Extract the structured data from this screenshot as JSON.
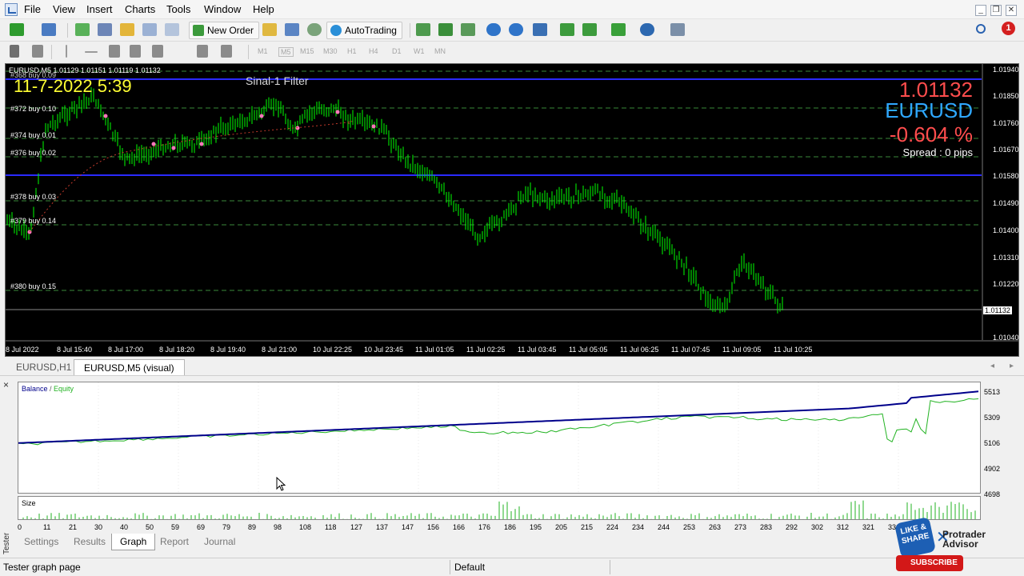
{
  "menu": [
    "File",
    "View",
    "Insert",
    "Charts",
    "Tools",
    "Window",
    "Help"
  ],
  "toolbar": {
    "new_order": "New Order",
    "autotrading": "AutoTrading",
    "timeframes": [
      "M1",
      "M5",
      "M15",
      "M30",
      "H1",
      "H4",
      "D1",
      "W1",
      "MN"
    ],
    "notification_count": "1"
  },
  "chart": {
    "symbol_line": "EURUSD,M5  1.01129 1.01151 1.01119 1.01132",
    "date_overlay": "11-7-2022 5:39",
    "ea_name": "Sinal-1 Filter",
    "price": "1.01132",
    "symbol": "EURUSD",
    "change": "-0.604 %",
    "spread": "Spread : 0 pips",
    "price_axis": [
      "1.01940",
      "1.01850",
      "1.01760",
      "1.01670",
      "1.01580",
      "1.01490",
      "1.01400",
      "1.01310",
      "1.01220",
      "1.01132",
      "1.01040"
    ],
    "current_price_tag": "1.01132",
    "time_axis": [
      "8 Jul 2022",
      "8 Jul 15:40",
      "8 Jul 17:00",
      "8 Jul 18:20",
      "8 Jul 19:40",
      "8 Jul 21:00",
      "10 Jul 22:25",
      "10 Jul 23:45",
      "11 Jul 01:05",
      "11 Jul 02:25",
      "11 Jul 03:45",
      "11 Jul 05:05",
      "11 Jul 06:25",
      "11 Jul 07:45",
      "11 Jul 09:05",
      "11 Jul 10:25"
    ],
    "orders": [
      "#368 buy 0.09",
      "#372 buy 0.10",
      "#374 buy 0.01",
      "#376 buy 0.02",
      "#378 buy 0.03",
      "#379 buy 0.14",
      "#380 buy 0.15"
    ]
  },
  "chart_tabs": [
    "EURUSD,H1",
    "EURUSD,M5 (visual)"
  ],
  "tester": {
    "legend_balance": "Balance",
    "legend_sep": " / ",
    "legend_equity": "Equity",
    "y_axis": [
      "5513",
      "5309",
      "5106",
      "4902",
      "4698"
    ],
    "size_label": "Size",
    "x_axis": [
      "0",
      "11",
      "21",
      "30",
      "40",
      "50",
      "59",
      "69",
      "79",
      "89",
      "98",
      "108",
      "118",
      "127",
      "137",
      "147",
      "156",
      "166",
      "176",
      "186",
      "195",
      "205",
      "215",
      "224",
      "234",
      "244",
      "253",
      "263",
      "273",
      "283",
      "292",
      "302",
      "312",
      "321",
      "331"
    ],
    "tabs": [
      "Settings",
      "Results",
      "Graph",
      "Report",
      "Journal"
    ],
    "side_label": "Tester",
    "close": "×"
  },
  "status": {
    "left": "Tester graph page",
    "profile": "Default"
  },
  "watermark": {
    "like": "LIKE & SHARE",
    "subscribe": "SUBSCRIBE",
    "brand_line1": "Protrader",
    "brand_line2": "Advisor"
  },
  "colors": {
    "candle": "#00ff00",
    "balance": "#00008b",
    "equity": "#22b322",
    "order_line": "#2a2aff"
  }
}
